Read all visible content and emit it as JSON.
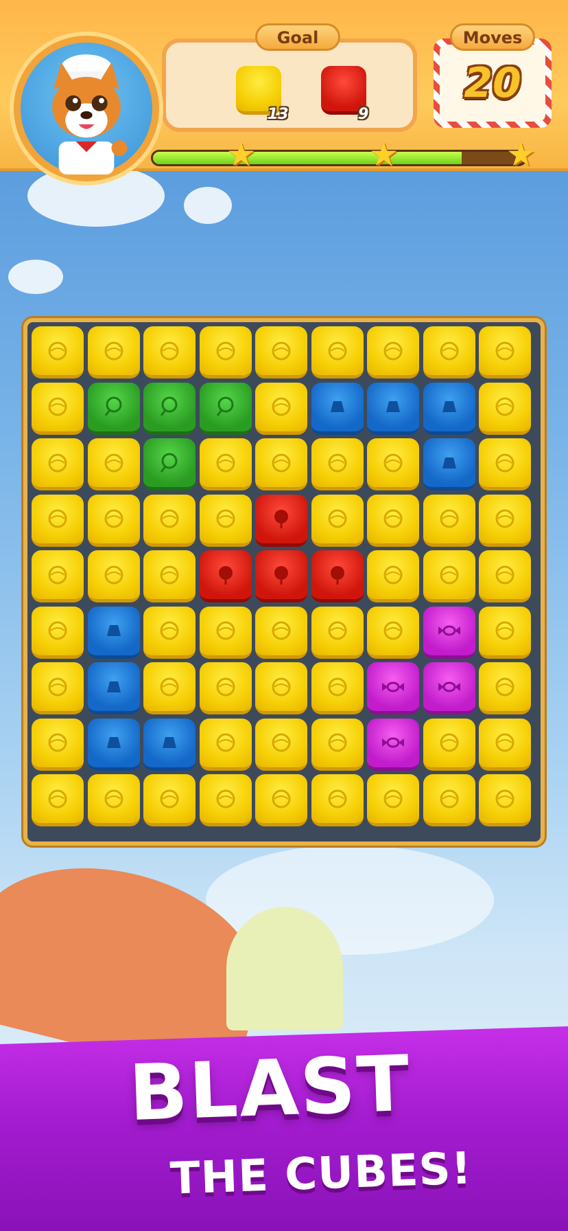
{
  "hud": {
    "goal_label": "Goal",
    "moves_label": "Moves",
    "moves_value": "20",
    "goals": [
      {
        "cube": "yellow",
        "count": "13"
      },
      {
        "cube": "red",
        "count": "9"
      }
    ],
    "progress": 0.83,
    "stars": 3
  },
  "colors": {
    "yellow": "#f6cf06",
    "green": "#2a9c22",
    "blue": "#1468c8",
    "red": "#d0160c",
    "purple": "#c21ccc",
    "banner": "#a41cd0"
  },
  "board": {
    "rows": 9,
    "cols": 9,
    "grid": [
      [
        "Y",
        "Y",
        "Y",
        "Y",
        "Y",
        "Y",
        "Y",
        "Y",
        "Y"
      ],
      [
        "Y",
        "G",
        "G",
        "G",
        "Y",
        "B",
        "B",
        "B",
        "Y"
      ],
      [
        "Y",
        "Y",
        "G",
        "Y",
        "Y",
        "Y",
        "Y",
        "B",
        "Y"
      ],
      [
        "Y",
        "Y",
        "Y",
        "Y",
        "R",
        "Y",
        "Y",
        "Y",
        "Y"
      ],
      [
        "Y",
        "Y",
        "Y",
        "R",
        "R",
        "R",
        "Y",
        "Y",
        "Y"
      ],
      [
        "Y",
        "B",
        "Y",
        "Y",
        "Y",
        "Y",
        "Y",
        "P",
        "Y"
      ],
      [
        "Y",
        "B",
        "Y",
        "Y",
        "Y",
        "Y",
        "P",
        "P",
        "Y"
      ],
      [
        "Y",
        "B",
        "B",
        "Y",
        "Y",
        "Y",
        "P",
        "Y",
        "Y"
      ],
      [
        "Y",
        "Y",
        "Y",
        "Y",
        "Y",
        "Y",
        "Y",
        "Y",
        "Y"
      ]
    ]
  },
  "banner": {
    "line1": "BLAST",
    "line2": "THE CUBES!"
  }
}
